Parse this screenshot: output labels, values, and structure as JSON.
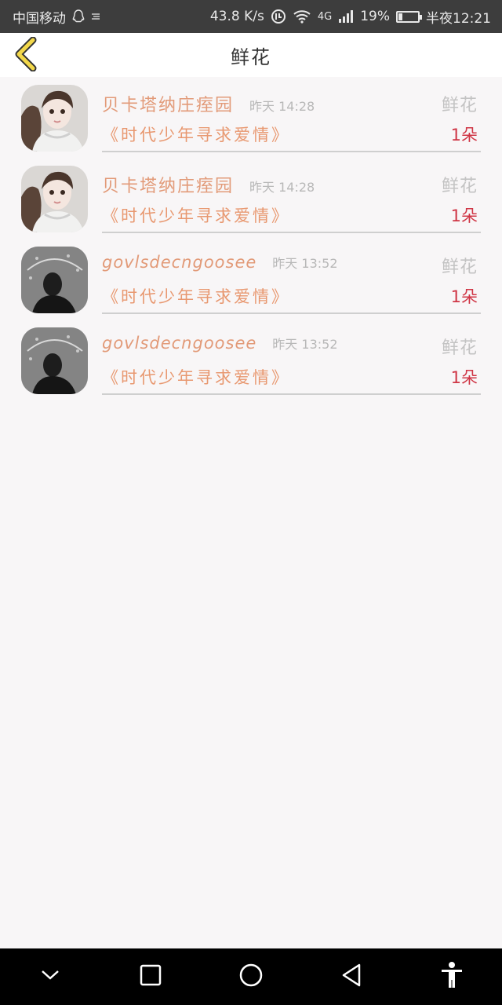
{
  "status_bar": {
    "carrier": "中国移动",
    "speed": "43.8 K/s",
    "network": "4G",
    "battery": "19%",
    "battery_level": 0.19,
    "time": "半夜12:21"
  },
  "header": {
    "title": "鲜花"
  },
  "items": [
    {
      "sender": "贝卡塔纳庄痓园",
      "time": "昨天 14:28",
      "gift": "鲜花",
      "book": "《时代少年寻求爱情》",
      "qty": "1朵",
      "avatar": "girl-portrait"
    },
    {
      "sender": "贝卡塔纳庄痓园",
      "time": "昨天 14:28",
      "gift": "鲜花",
      "book": "《时代少年寻求爱情》",
      "qty": "1朵",
      "avatar": "girl-portrait"
    },
    {
      "sender": "govlsdecngoosee",
      "time": "昨天 13:52",
      "gift": "鲜花",
      "book": "《时代少年寻求爱情》",
      "qty": "1朵",
      "avatar": "umbrella-silhouette"
    },
    {
      "sender": "govlsdecngoosee",
      "time": "昨天 13:52",
      "gift": "鲜花",
      "book": "《时代少年寻求爱情》",
      "qty": "1朵",
      "avatar": "umbrella-silhouette"
    }
  ],
  "colors": {
    "sender": "#e29a78",
    "book": "#e89870",
    "qty": "#cf3545",
    "back_icon": "#f3d84a"
  },
  "icons": {
    "back": "chevron-left-icon",
    "nav": [
      "chevron-down-icon",
      "square-icon",
      "circle-icon",
      "triangle-back-icon",
      "accessibility-icon"
    ]
  }
}
